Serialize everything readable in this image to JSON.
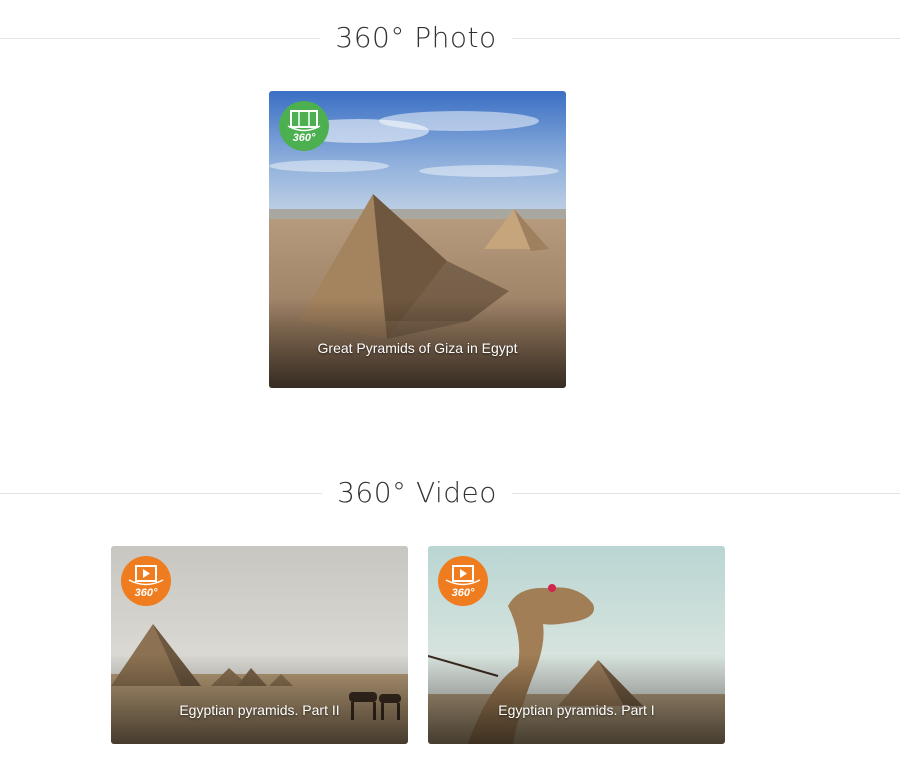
{
  "photo_section": {
    "title": "360° Photo",
    "items": [
      {
        "caption": "Great Pyramids of Giza in Egypt",
        "badge": "360°",
        "badge_icon": "panorama-360-icon",
        "badge_color": "#4caf50"
      }
    ]
  },
  "video_section": {
    "title": "360° Video",
    "items": [
      {
        "caption": "Egyptian pyramids. Part II",
        "badge": "360°",
        "badge_icon": "video-360-icon",
        "badge_color": "#ef7d1f"
      },
      {
        "caption": "Egyptian pyramids. Part I",
        "badge": "360°",
        "badge_icon": "video-360-icon",
        "badge_color": "#ef7d1f"
      }
    ]
  }
}
